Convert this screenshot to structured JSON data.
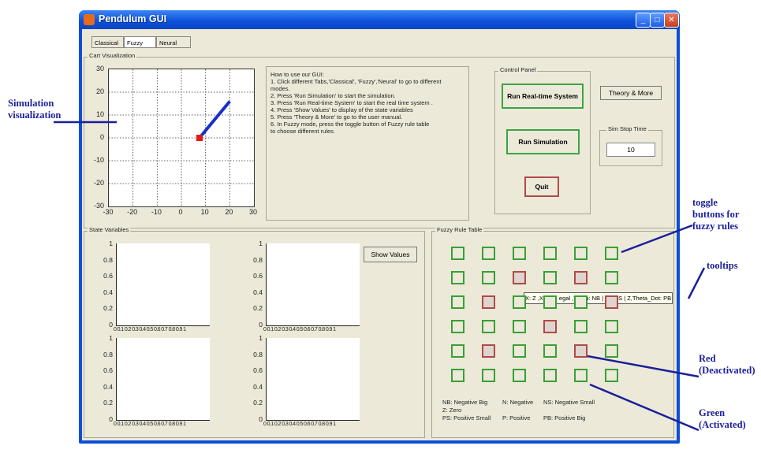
{
  "window": {
    "title": "Pendulum GUI",
    "controls": [
      "minimize-icon",
      "maximize-icon",
      "close-icon"
    ]
  },
  "mode_tabs": [
    "Classical",
    "Fuzzy",
    "Neural"
  ],
  "active_mode": "Fuzzy",
  "cart_visualization": {
    "label": "Cart Visualization",
    "x_ticks": [
      "-30",
      "-20",
      "-10",
      "0",
      "10",
      "20",
      "30"
    ],
    "y_ticks": [
      "30",
      "20",
      "10",
      "0",
      "-10",
      "-20",
      "-30"
    ]
  },
  "instructions": {
    "heading": "How to use our GUI:",
    "lines": [
      "1. Click different Tabs,'Classical', 'Fuzzy','Neural' to go to different",
      "modes.",
      "2. Press 'Run Simulation' to start the simulation.",
      "3. Press 'Run Real-time System' to start the real time system .",
      "4. Press 'Show Values' to display of the state variables",
      "5. Press 'Theory & More' to go to the user manual.",
      "6. In Fuzzy mode, press the toggle button of Fuzzy rule table",
      "to choose different rules."
    ]
  },
  "control_panel": {
    "label": "Control Panel",
    "run_realtime": "Run Real-time System",
    "run_simulation": "Run Simulation",
    "quit": "Quit"
  },
  "theory_button": "Theory & More",
  "sim_stop_time": {
    "label": "Sim Stop Time",
    "value": "10"
  },
  "state_variables": {
    "label": "State Variables",
    "show_values": "Show Values",
    "y_ticks": [
      "1",
      "0.8",
      "0.6",
      "0.4",
      "0.2",
      "0"
    ],
    "x_ticks": "0 0.1 0.2 0.3 0.4 0.5 0.6 0.7 0.8 0.9 1"
  },
  "fuzzy_rule_table": {
    "label": "Fuzzy Rule Table",
    "rows": [
      [
        "on",
        "on",
        "on",
        "on",
        "on",
        "on"
      ],
      [
        "on",
        "on",
        "off",
        "on",
        "off",
        "on"
      ],
      [
        "on",
        "off",
        "on",
        "on",
        "on",
        "off"
      ],
      [
        "on",
        "on",
        "on",
        "off",
        "on",
        "on"
      ],
      [
        "on",
        "off",
        "on",
        "on",
        "off",
        "on"
      ],
      [
        "on",
        "on",
        "on",
        "on",
        "on",
        ""
      ]
    ],
    "tooltip": "X: Z ,X_Dot: egal ,Theta: NB | N | NS | Z,Theta_Dot: PB",
    "legend": {
      "nb": "NB: Negative Big",
      "n": "N: Negative",
      "ns": "NS: Negative Small",
      "z": "Z: Zero",
      "ps": "PS: Positive Small",
      "p": "P: Positive",
      "pb": "PB: Positive Big"
    }
  },
  "annotations": {
    "simulation": [
      "Simulation",
      "visualization"
    ],
    "toggle": [
      "toggle",
      "buttons for",
      "fuzzy rules"
    ],
    "tooltips": "tooltips",
    "red": [
      "Red",
      "(Deactivated)"
    ],
    "green": [
      "Green",
      "(Activated)"
    ]
  },
  "colors": {
    "activated": "#38a036",
    "deactivated": "#b04a4a",
    "annotation": "#1b1f9a",
    "titlebar": "#0b4fd8"
  }
}
